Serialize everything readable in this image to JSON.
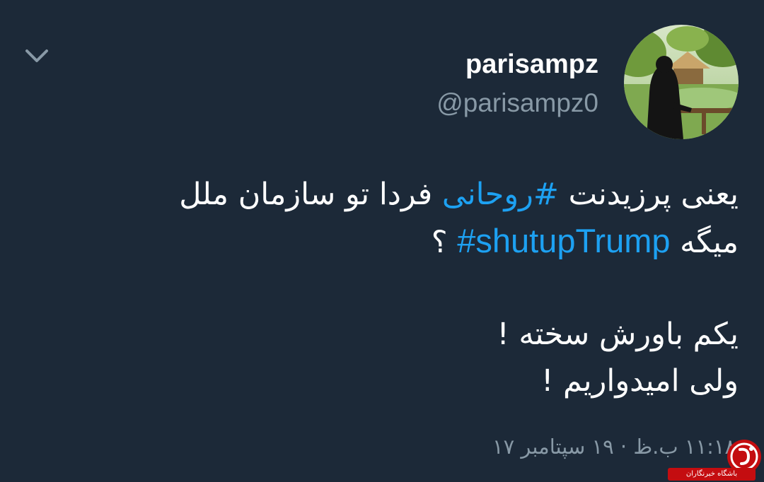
{
  "header": {
    "display_name": "parisampz",
    "handle": "@parisampz0",
    "menu_icon": "chevron-down-icon",
    "avatar_icon": "user-avatar-photo"
  },
  "tweet": {
    "line1_before": "یعنی پرزیدنت ",
    "line1_hashtag": "#روحانی",
    "line1_after": " فردا تو سازمان ملل",
    "line2_before": "میگه ",
    "line2_hashtag": "#shutupTrump",
    "line2_after": " ؟",
    "line3": "یکم باورش سخته !",
    "line4": "ولی امیدواریم !"
  },
  "timestamp": "۱۱:۱۸ ب.ظ · ۱۹ سپتامبر ۱۷",
  "watermark": {
    "text": "باشگاه خبرنگاران",
    "logo_icon": "yjc-logo"
  },
  "colors": {
    "background": "#1c2938",
    "text_primary": "#ffffff",
    "text_secondary": "#8899a6",
    "hashtag": "#1da1f2",
    "watermark_red": "#c40d10"
  }
}
